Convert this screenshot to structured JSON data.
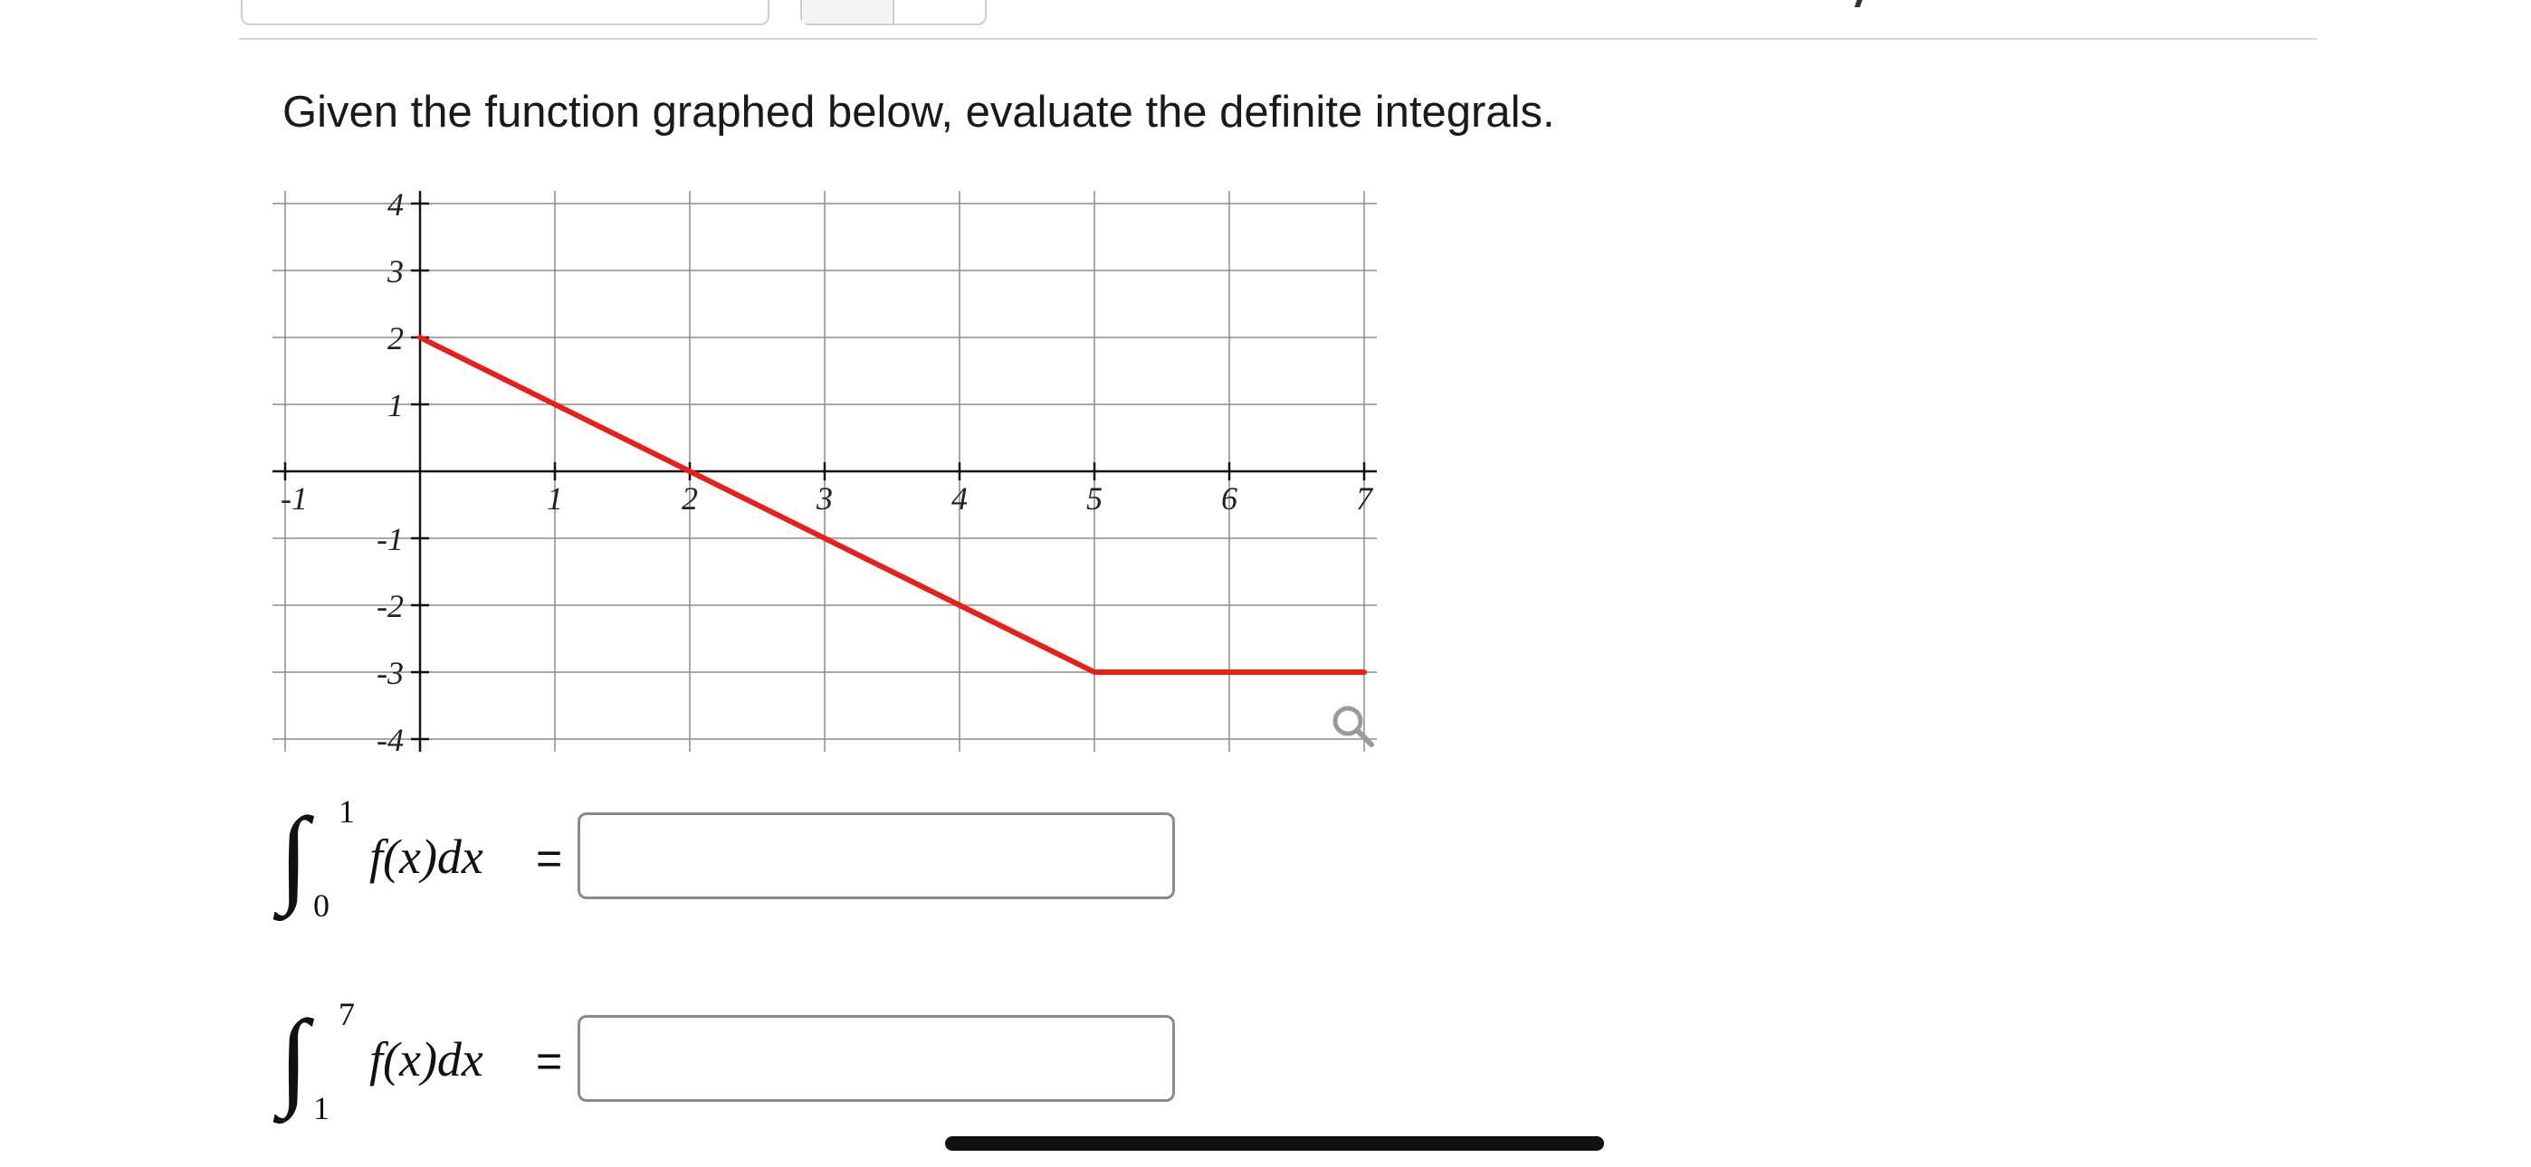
{
  "question": {
    "text": "Given the function graphed below, evaluate the definite integrals."
  },
  "chart_data": {
    "type": "line",
    "xlim": [
      -1,
      7
    ],
    "ylim": [
      -4,
      4
    ],
    "x_ticks": [
      -1,
      1,
      2,
      3,
      4,
      5,
      6,
      7
    ],
    "y_ticks": [
      4,
      3,
      2,
      1,
      -1,
      -2,
      -3,
      -4
    ],
    "x_tick_labels": [
      "-1",
      "1",
      "2",
      "3",
      "4",
      "5",
      "6",
      "7"
    ],
    "y_tick_labels": [
      "4",
      "3",
      "2",
      "1",
      "-1",
      "-2",
      "-3",
      "-4"
    ],
    "grid": true,
    "series": [
      {
        "color": "#e8201a",
        "x": [
          0,
          5,
          7
        ],
        "y": [
          2,
          -3,
          -3
        ]
      }
    ],
    "zoom_icon": "magnifier-icon"
  },
  "integrals": [
    {
      "lower": "0",
      "upper": "1",
      "expr": "f(x)dx",
      "eq": "=",
      "answer": ""
    },
    {
      "lower": "1",
      "upper": "7",
      "expr": "f(x)dx",
      "eq": "=",
      "answer": ""
    }
  ]
}
